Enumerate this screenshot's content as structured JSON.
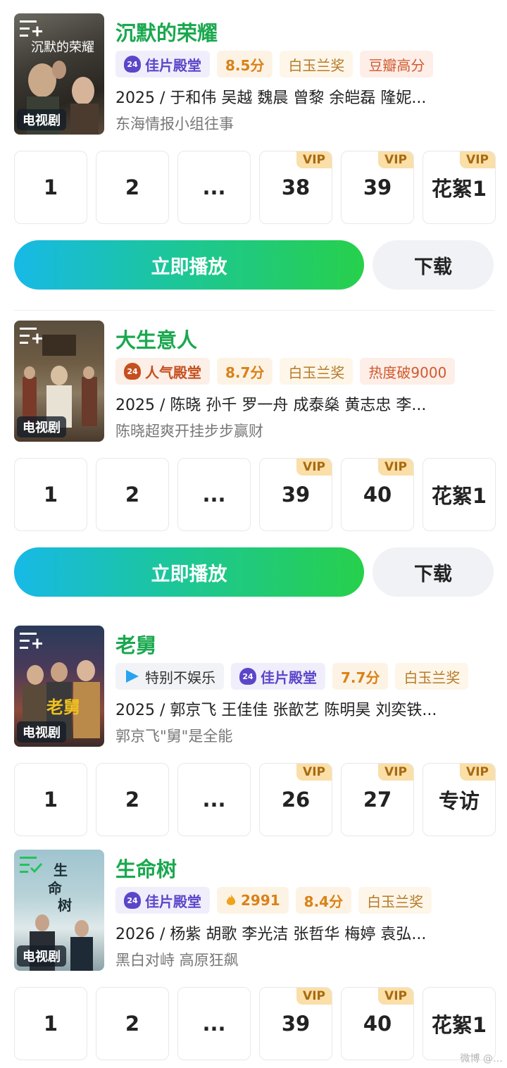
{
  "genre_label": "电视剧",
  "vip_label": "VIP",
  "play_label": "立即播放",
  "download_label": "下载",
  "watermark_text": "微博 @…",
  "colors": {
    "title_green": "#1aa84f",
    "play_gradient_start": "#17b9e6",
    "play_gradient_end": "#27d04b",
    "vip_badge": "#fbdfa8"
  },
  "cards": [
    {
      "title": "沉默的荣耀",
      "poster_caption": "沉默的荣耀",
      "tags": [
        "佳片殿堂",
        "8.5分",
        "白玉兰奖",
        "豆瓣高分"
      ],
      "info": "2025 / 于和伟  吴越  魏晨  曾黎  余皑磊  隆妮...",
      "sub": "东海情报小组往事",
      "episodes": [
        "1",
        "2",
        "...",
        "38",
        "39",
        "花絮1"
      ]
    },
    {
      "title": "大生意人",
      "tags": [
        "人气殿堂",
        "8.7分",
        "白玉兰奖",
        "热度破9000"
      ],
      "info": "2025 / 陈晓  孙千  罗一舟  成泰燊  黄志忠  李...",
      "sub": "陈晓超爽开挂步步赢财",
      "episodes": [
        "1",
        "2",
        "...",
        "39",
        "40",
        "花絮1"
      ]
    },
    {
      "title": "老舅",
      "tags": [
        "特别不娱乐",
        "佳片殿堂",
        "7.7分",
        "白玉兰奖"
      ],
      "info": "2025 / 郭京飞  王佳佳  张歆艺  陈明昊  刘奕铁...",
      "sub": "郭京飞\"舅\"是全能",
      "episodes": [
        "1",
        "2",
        "...",
        "26",
        "27",
        "专访"
      ]
    },
    {
      "title": "生命树",
      "poster_caption": "生命树",
      "tags": [
        "佳片殿堂",
        "2991",
        "8.4分",
        "白玉兰奖"
      ],
      "info": "2026 / 杨紫  胡歌  李光洁  张哲华  梅婷  袁弘...",
      "sub": "黑白对峙 高原狂飙",
      "episodes": [
        "1",
        "2",
        "...",
        "39",
        "40",
        "花絮1"
      ]
    }
  ]
}
